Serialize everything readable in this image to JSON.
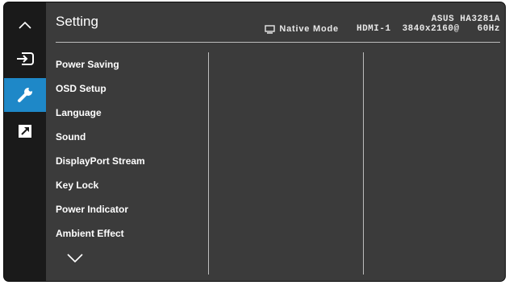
{
  "osd": {
    "title": "Setting",
    "model": "ASUS HA3281A",
    "status": {
      "mode_icon": "monitor-icon",
      "mode": "Native Mode",
      "input": "HDMI-1",
      "resolution": "3840x2160@",
      "refresh": "60Hz"
    },
    "sidebar": {
      "icons": [
        "chevron-up-icon",
        "input-select-icon",
        "wrench-icon",
        "shortcut-arrow-icon"
      ],
      "active": "wrench-icon",
      "accent_color": "#1e88c8"
    },
    "menu": [
      {
        "label": "Power Saving"
      },
      {
        "label": "OSD Setup"
      },
      {
        "label": "Language"
      },
      {
        "label": "Sound"
      },
      {
        "label": "DisplayPort Stream"
      },
      {
        "label": "Key Lock"
      },
      {
        "label": "Power Indicator"
      },
      {
        "label": "Ambient Effect"
      }
    ],
    "more_icon": "chevron-down-icon"
  }
}
